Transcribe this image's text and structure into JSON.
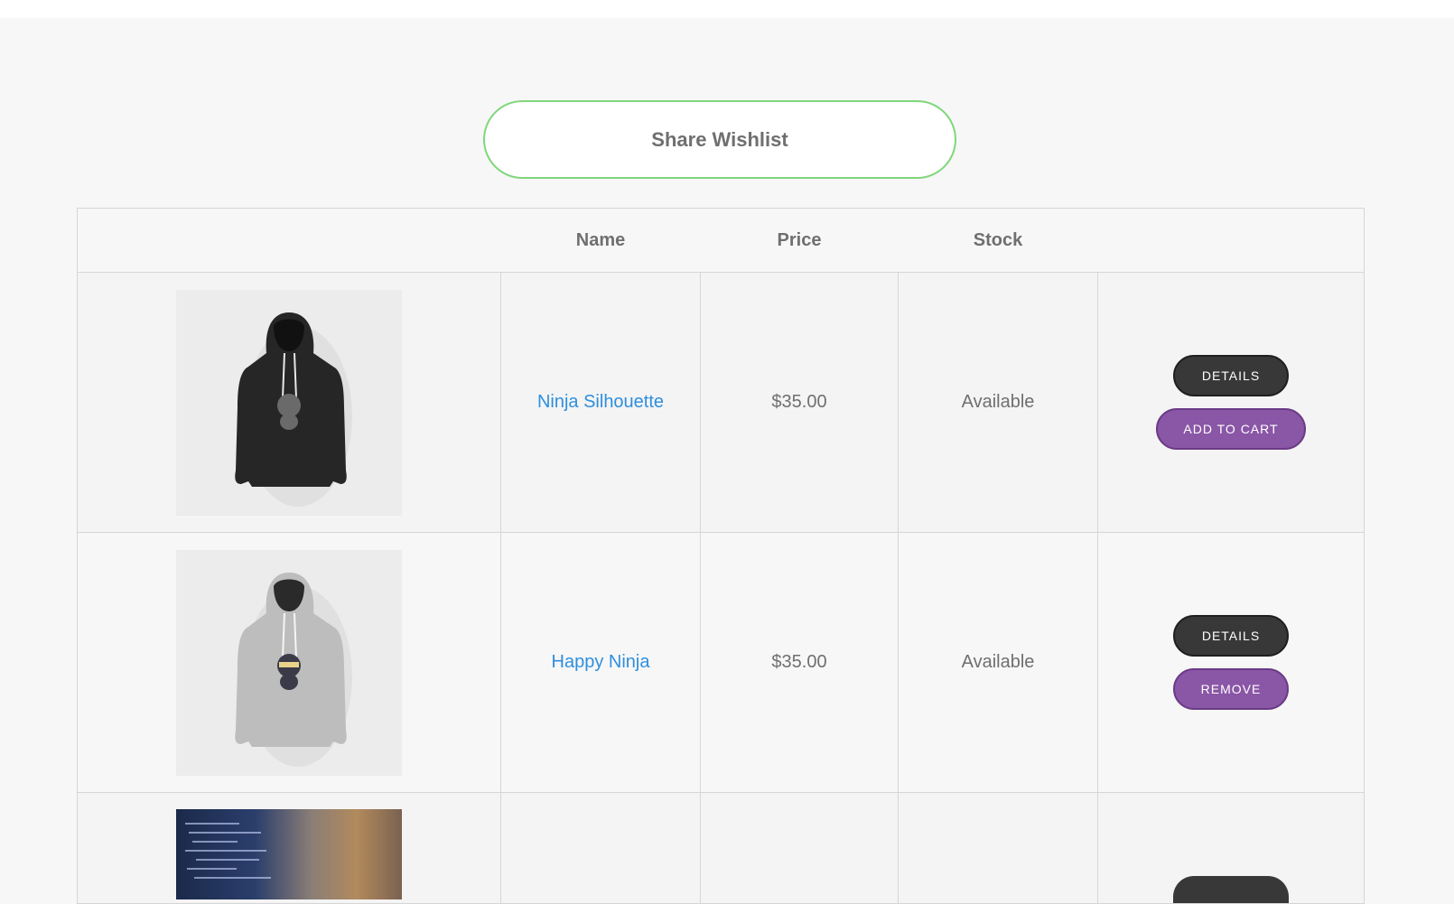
{
  "share_button_label": "Share Wishlist",
  "table": {
    "headers": [
      "",
      "Name",
      "Price",
      "Stock",
      ""
    ]
  },
  "products": [
    {
      "name": "Ninja Silhouette",
      "price": "$35.00",
      "stock": "Available",
      "image": "black-hoodie-image",
      "primary_action": "Details",
      "secondary_action": "Add to cart"
    },
    {
      "name": "Happy Ninja",
      "price": "$35.00",
      "stock": "Available",
      "image": "grey-hoodie-image",
      "primary_action": "Details",
      "secondary_action": "Remove"
    },
    {
      "image": "laptop-code-image"
    }
  ],
  "colors": {
    "link": "#2f8fdd",
    "purple_button": "#8a56a6",
    "dark_button": "#383838",
    "share_border": "#7fd77a"
  }
}
